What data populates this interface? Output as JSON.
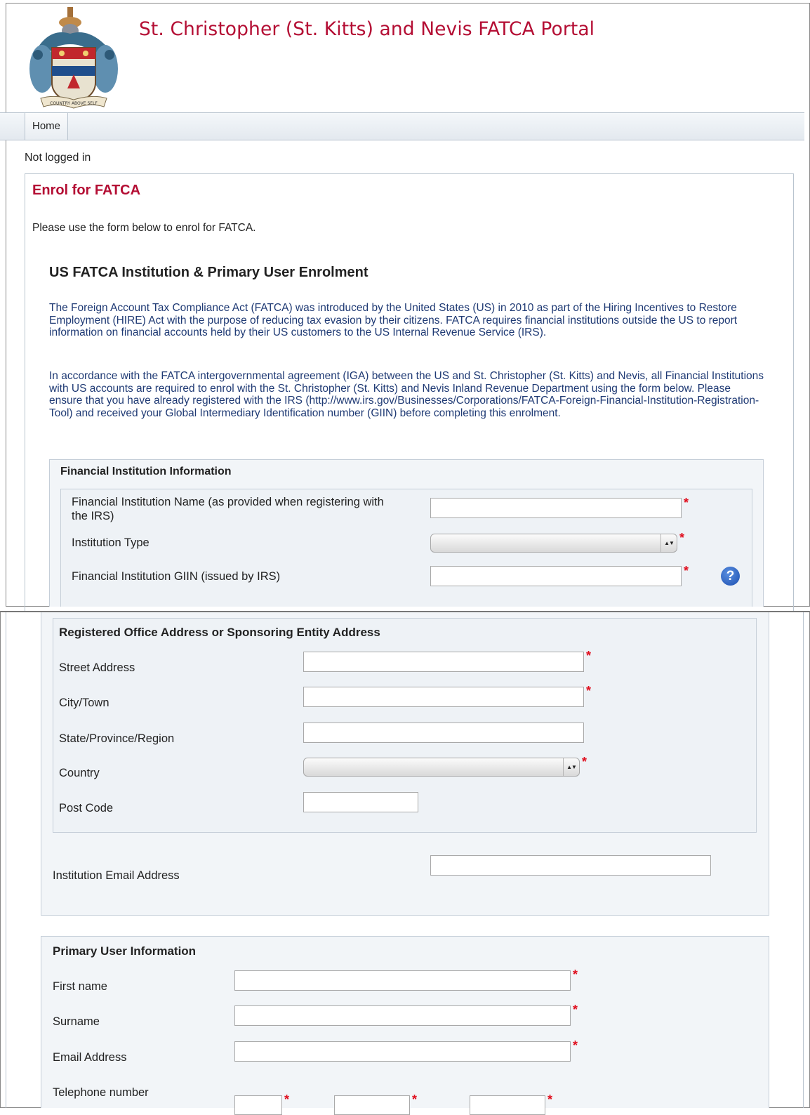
{
  "header": {
    "title": "St. Christopher (St. Kitts) and Nevis FATCA Portal",
    "crest_motto": "COUNTRY ABOVE SELF"
  },
  "nav": {
    "home_label": "Home"
  },
  "status": {
    "login_text": "Not logged in"
  },
  "page": {
    "heading": "Enrol for FATCA",
    "intro": "Please use the form below to enrol for FATCA.",
    "section_heading": "US FATCA Institution & Primary User Enrolment",
    "paragraph1": "The Foreign Account Tax Compliance Act (FATCA) was introduced by the United States (US) in 2010 as part of the Hiring Incentives to Restore Employment (HIRE) Act with the purpose of reducing tax evasion by their citizens. FATCA requires financial institutions outside the US to report information on financial accounts held by their US customers to the US Internal Revenue Service (IRS).",
    "paragraph2": "In accordance with the FATCA intergovernmental agreement (IGA) between the US and St. Christopher (St. Kitts) and Nevis, all Financial Institutions with US accounts are required to enrol with the St. Christopher (St. Kitts) and Nevis Inland Revenue Department using the form below. Please ensure that you have already registered with the IRS (http://www.irs.gov/Businesses/Corporations/FATCA-Foreign-Financial-Institution-Registration-Tool) and received your Global Intermediary Identification number (GIIN) before completing this enrolment."
  },
  "fi_section": {
    "legend": "Financial Institution Information",
    "name_label": "Financial Institution Name (as provided when registering with the IRS)",
    "type_label": "Institution Type",
    "giin_label": "Financial Institution GIIN (issued by IRS)",
    "name_value": "",
    "type_value": "",
    "giin_value": ""
  },
  "address_section": {
    "legend": "Registered Office Address or Sponsoring Entity Address",
    "street_label": "Street Address",
    "city_label": "City/Town",
    "state_label": "State/Province/Region",
    "country_label": "Country",
    "postcode_label": "Post Code",
    "street_value": "",
    "city_value": "",
    "state_value": "",
    "country_value": "",
    "postcode_value": ""
  },
  "email_section": {
    "email_label": "Institution Email Address",
    "email_value": ""
  },
  "user_section": {
    "legend": "Primary User Information",
    "first_name_label": "First name",
    "surname_label": "Surname",
    "email_label": "Email Address",
    "phone_label": "Telephone number",
    "first_name_value": "",
    "surname_value": "",
    "email_value": "",
    "phone_values": [
      "",
      "",
      ""
    ]
  },
  "required_marker": "*",
  "help_glyph": "?",
  "select_arrow_glyph": "▲▼",
  "colors": {
    "brand_red": "#b40e34",
    "required_red": "#e0101f",
    "paragraph_blue": "#1f3a74",
    "panel_bg": "#f2f5f8",
    "help_blue": "#1c4fb0"
  }
}
